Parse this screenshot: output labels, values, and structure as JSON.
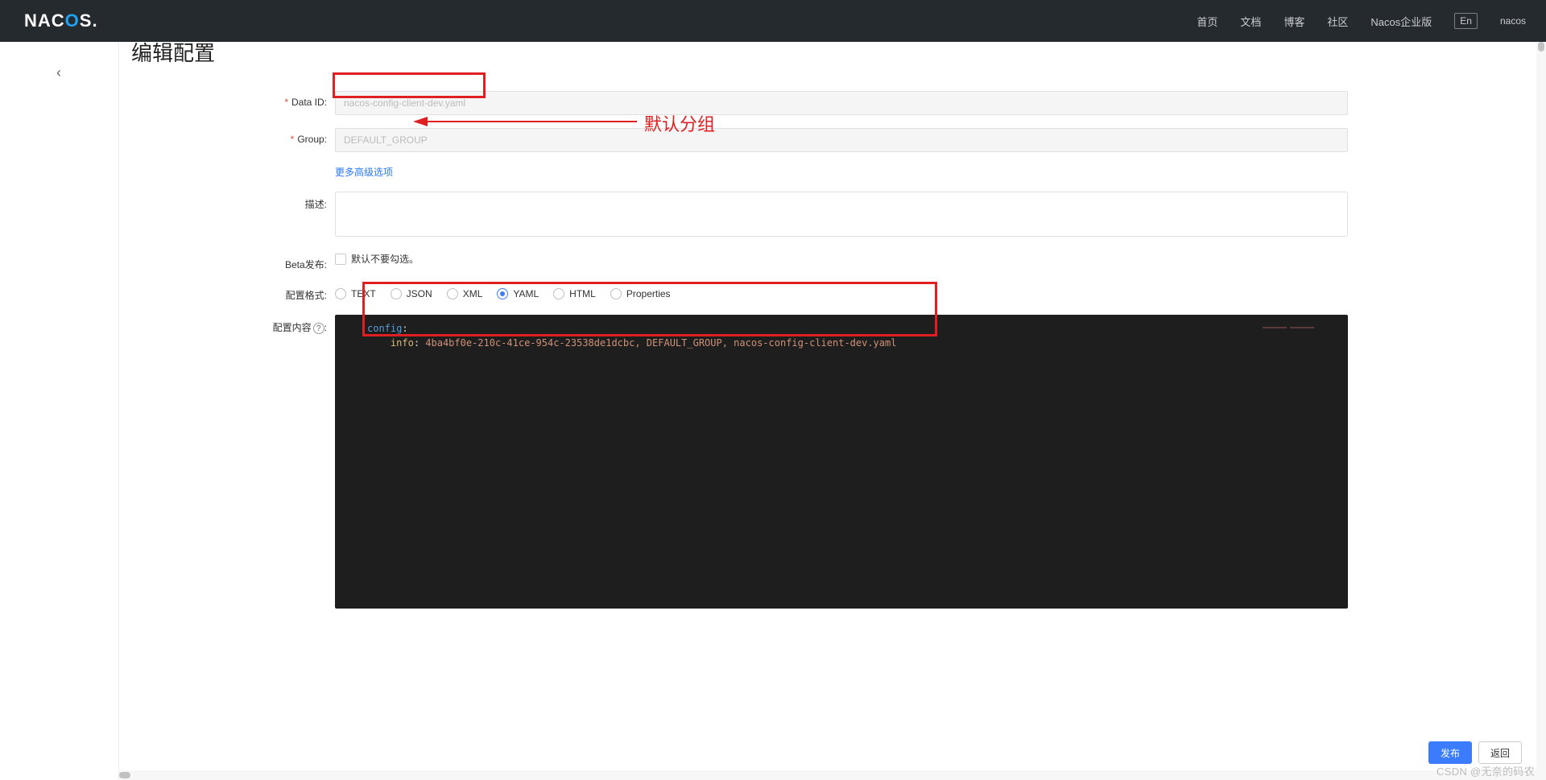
{
  "header": {
    "logo_pre": "NAC",
    "logo_mid": "O",
    "logo_post": "S.",
    "nav": [
      "首页",
      "文档",
      "博客",
      "社区",
      "Nacos企业版"
    ],
    "lang": "En",
    "user": "nacos"
  },
  "page": {
    "title": "编辑配置"
  },
  "form": {
    "dataid": {
      "label": "Data ID:",
      "value": "nacos-config-client-dev.yaml"
    },
    "group": {
      "label": "Group:",
      "value": "DEFAULT_GROUP"
    },
    "more_link": "更多高级选项",
    "desc": {
      "label": "描述:"
    },
    "beta": {
      "label": "Beta发布:",
      "hint": "默认不要勾选。"
    },
    "format": {
      "label": "配置格式:",
      "options": [
        "TEXT",
        "JSON",
        "XML",
        "YAML",
        "HTML",
        "Properties"
      ],
      "selected": "YAML"
    },
    "content": {
      "label": "配置内容",
      "help": "?",
      "code_key1": "config",
      "code_key2": "info",
      "code_val": "4ba4bf0e-210c-41ce-954c-23538de1dcbc, DEFAULT_GROUP, nacos-config-client-dev.yaml"
    }
  },
  "annotations": {
    "group_hint": "默认分组"
  },
  "footer": {
    "publish": "发布",
    "back": "返回"
  },
  "watermark": "CSDN @无奈的码农"
}
